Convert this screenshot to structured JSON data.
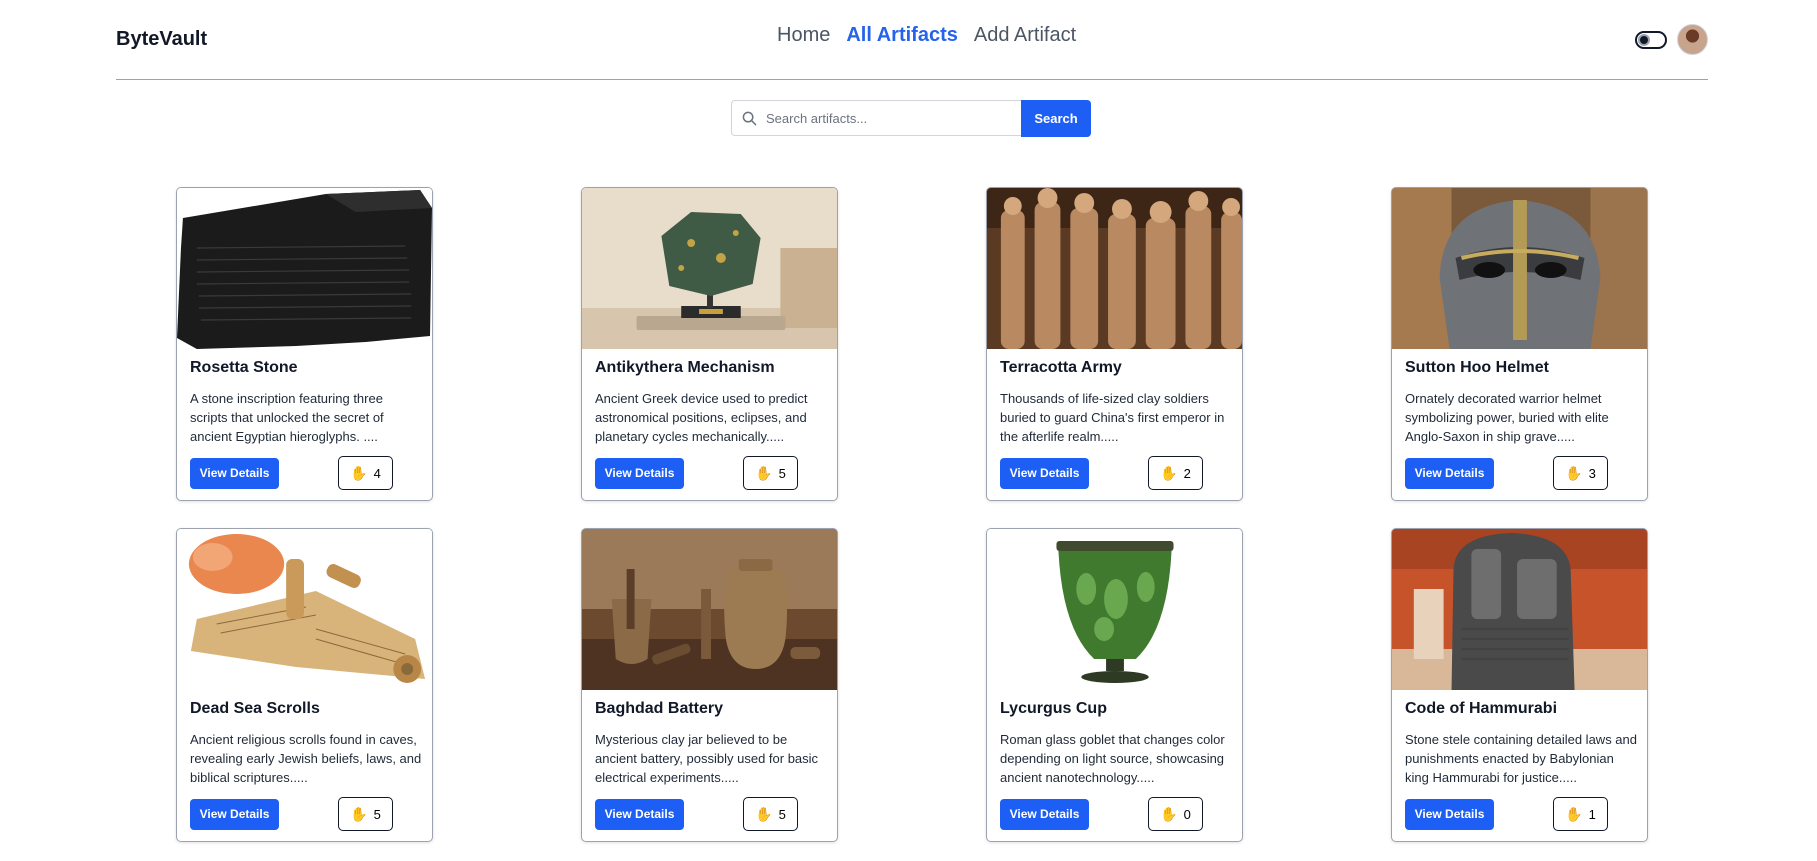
{
  "brand": "ByteVault",
  "nav": {
    "home": "Home",
    "all_artifacts": "All Artifacts",
    "add_artifact": "Add Artifact"
  },
  "search": {
    "placeholder": "Search artifacts...",
    "button": "Search"
  },
  "colors": {
    "accent": "#1d5ef5",
    "active_link": "#2563eb"
  },
  "icons": {
    "search": "search-icon",
    "like": "hand-icon",
    "theme": "theme-toggle",
    "user": "avatar"
  },
  "artifacts": [
    {
      "title": "Rosetta Stone",
      "description": "A stone inscription featuring three scripts that unlocked the secret of ancient Egyptian hieroglyphs. ....",
      "button": "View Details",
      "likes": "4"
    },
    {
      "title": "Antikythera Mechanism",
      "description": "Ancient Greek device used to predict astronomical positions, eclipses, and planetary cycles mechanically.....",
      "button": "View Details",
      "likes": "5"
    },
    {
      "title": "Terracotta Army",
      "description": "Thousands of life-sized clay soldiers buried to guard China's first emperor in the afterlife realm.....",
      "button": "View Details",
      "likes": "2"
    },
    {
      "title": "Sutton Hoo Helmet",
      "description": "Ornately decorated warrior helmet symbolizing power, buried with elite Anglo-Saxon in ship grave.....",
      "button": "View Details",
      "likes": "3"
    },
    {
      "title": "Dead Sea Scrolls",
      "description": "Ancient religious scrolls found in caves, revealing early Jewish beliefs, laws, and biblical scriptures.....",
      "button": "View Details",
      "likes": "5"
    },
    {
      "title": "Baghdad Battery",
      "description": "Mysterious clay jar believed to be ancient battery, possibly used for basic electrical experiments.....",
      "button": "View Details",
      "likes": "5"
    },
    {
      "title": "Lycurgus Cup",
      "description": "Roman glass goblet that changes color depending on light source, showcasing ancient nanotechnology.....",
      "button": "View Details",
      "likes": "0"
    },
    {
      "title": "Code of Hammurabi",
      "description": "Stone stele containing detailed laws and punishments enacted by Babylonian king Hammurabi for justice.....",
      "button": "View Details",
      "likes": "1"
    }
  ]
}
